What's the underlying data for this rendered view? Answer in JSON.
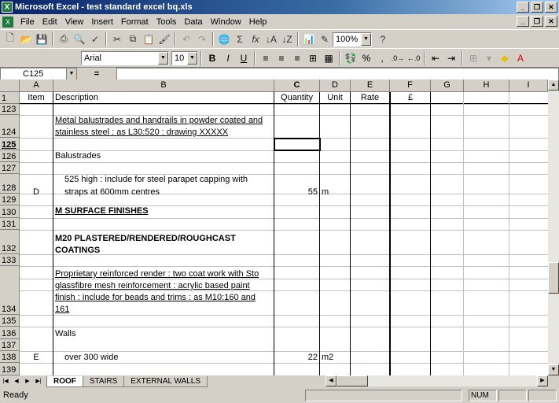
{
  "window": {
    "title": "Microsoft Excel - test standard excel bq.xls"
  },
  "menu": [
    "File",
    "Edit",
    "View",
    "Insert",
    "Format",
    "Tools",
    "Data",
    "Window",
    "Help"
  ],
  "toolbar": {
    "zoom": "100%",
    "font": "Arial",
    "size": "10"
  },
  "formula_bar": {
    "name_box": "C125",
    "equals": "=",
    "formula": ""
  },
  "columns": [
    "A",
    "B",
    "C",
    "D",
    "E",
    "F",
    "G",
    "H",
    "I"
  ],
  "header_row": {
    "num": "1",
    "item": "Item",
    "description": "Description",
    "quantity": "Quantity",
    "unit": "Unit",
    "rate": "Rate",
    "amount": "£"
  },
  "rows": [
    {
      "num": "123",
      "item": "",
      "desc": "",
      "qty": "",
      "unit": ""
    },
    {
      "num": "124",
      "item": "",
      "desc": "Metal balustrades and handrails in powder coated and stainless steel : as L30:520 : drawing XXXXX",
      "qty": "",
      "unit": ""
    },
    {
      "num": "125",
      "item": "",
      "desc": "",
      "qty": "",
      "unit": ""
    },
    {
      "num": "126",
      "item": "",
      "desc": "Balustrades",
      "qty": "",
      "unit": ""
    },
    {
      "num": "127",
      "item": "",
      "desc": "",
      "qty": "",
      "unit": ""
    },
    {
      "num": "128",
      "item": "D",
      "desc": "525 high : include for steel parapet capping with straps at 600mm centres",
      "qty": "55",
      "unit": "m"
    },
    {
      "num": "129",
      "item": "",
      "desc": "",
      "qty": "",
      "unit": ""
    },
    {
      "num": "130",
      "item": "",
      "desc": "M SURFACE FINISHES",
      "qty": "",
      "unit": ""
    },
    {
      "num": "131",
      "item": "",
      "desc": "",
      "qty": "",
      "unit": ""
    },
    {
      "num": "132",
      "item": "",
      "desc": "M20 PLASTERED/RENDERED/ROUGHCAST COATINGS",
      "qty": "",
      "unit": ""
    },
    {
      "num": "133",
      "item": "",
      "desc": "",
      "qty": "",
      "unit": ""
    },
    {
      "num": "134",
      "item": "",
      "desc": "Proprietary reinforced render : two coat work with Sto glassfibre mesh reinforcement : acrylic based paint finish : include for beads and trims : as M10:160 and 161",
      "qty": "",
      "unit": ""
    },
    {
      "num": "135",
      "item": "",
      "desc": "",
      "qty": "",
      "unit": ""
    },
    {
      "num": "136",
      "item": "",
      "desc": "Walls",
      "qty": "",
      "unit": ""
    },
    {
      "num": "137",
      "item": "",
      "desc": "",
      "qty": "",
      "unit": ""
    },
    {
      "num": "138",
      "item": "E",
      "desc": "over 300 wide",
      "qty": "22",
      "unit": "m2"
    },
    {
      "num": "139",
      "item": "",
      "desc": "",
      "qty": "",
      "unit": ""
    }
  ],
  "desc_lines": {
    "r124a": "Metal balustrades and handrails in powder coated and",
    "r124b": "stainless steel : as L30:520 : drawing XXXXX",
    "r128a": "525 high : include for steel parapet capping with",
    "r128b": "straps at 600mm centres",
    "r132a": "M20 PLASTERED/RENDERED/ROUGHCAST",
    "r132b": "COATINGS",
    "r134a": "Proprietary reinforced render : two coat work with Sto",
    "r134b": "glassfibre mesh reinforcement : acrylic based paint",
    "r134c": "finish : include for beads and trims : as M10:160 and",
    "r134d": "161"
  },
  "tabs": [
    "ROOF",
    "STAIRS",
    "EXTERNAL WALLS"
  ],
  "status": {
    "ready": "Ready",
    "num": "NUM"
  }
}
